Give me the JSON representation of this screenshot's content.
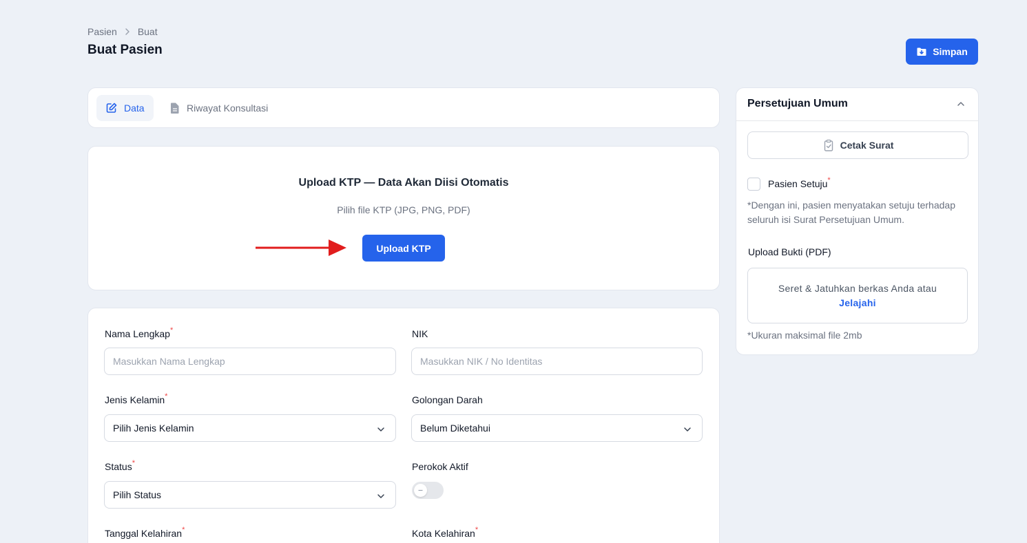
{
  "breadcrumb": {
    "parent": "Pasien",
    "current": "Buat"
  },
  "page_title": "Buat Pasien",
  "save_label": "Simpan",
  "tabs": [
    {
      "label": "Data",
      "icon": "edit-icon",
      "active": true
    },
    {
      "label": "Riwayat Konsultasi",
      "icon": "document-icon",
      "active": false
    }
  ],
  "upload": {
    "title": "Upload KTP — Data Akan Diisi Otomatis",
    "subtitle": "Pilih file KTP (JPG, PNG, PDF)",
    "button_label": "Upload KTP"
  },
  "form": {
    "nama": {
      "label": "Nama Lengkap",
      "required": "*",
      "placeholder": "Masukkan Nama Lengkap"
    },
    "nik": {
      "label": "NIK",
      "placeholder": "Masukkan NIK / No Identitas"
    },
    "jenis_kelamin": {
      "label": "Jenis Kelamin",
      "required": "*",
      "value": "Pilih Jenis Kelamin"
    },
    "golongan_darah": {
      "label": "Golongan Darah",
      "value": "Belum Diketahui"
    },
    "status": {
      "label": "Status",
      "required": "*",
      "value": "Pilih Status"
    },
    "perokok": {
      "label": "Perokok Aktif",
      "on": false
    },
    "tanggal_lahir": {
      "label": "Tanggal Kelahiran",
      "required": "*"
    },
    "kota_lahir": {
      "label": "Kota Kelahiran",
      "required": "*"
    }
  },
  "consent": {
    "title": "Persetujuan Umum",
    "print_label": "Cetak Surat",
    "checkbox_label": "Pasien Setuju",
    "required": "*",
    "note": "*Dengan ini, pasien menyatakan setuju terhadap seluruh isi Surat Persetujuan Umum.",
    "upload_label": "Upload Bukti (PDF)",
    "dropzone_text": "Seret & Jatuhkan berkas Anda atau",
    "dropzone_link": "Jelajahi",
    "size_note": "*Ukuran maksimal file 2mb"
  },
  "colors": {
    "accent": "#2563eb",
    "required": "#ef4444",
    "annotation_arrow": "#e11d1d"
  }
}
